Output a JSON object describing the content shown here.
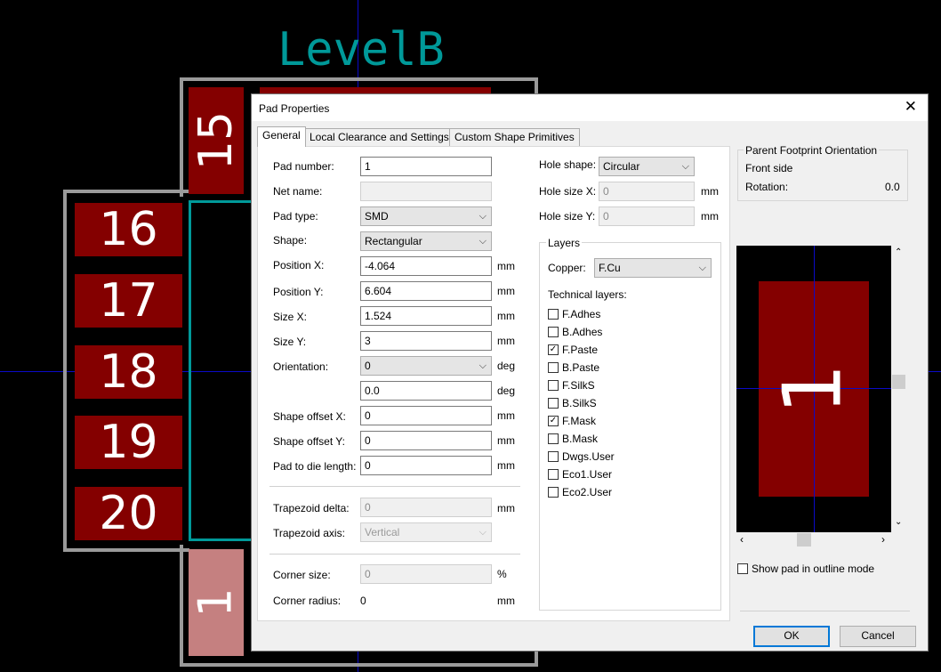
{
  "pcb": {
    "footprint_label": "LevelB",
    "pads_left": [
      "16",
      "17",
      "18",
      "19",
      "20"
    ],
    "pad_top": "15",
    "pad_bottom_selected": "1"
  },
  "dialog": {
    "title": "Pad Properties",
    "tabs": [
      "General",
      "Local Clearance and Settings",
      "Custom Shape Primitives"
    ],
    "fields": {
      "pad_number": {
        "label": "Pad number:",
        "value": "1"
      },
      "net_name": {
        "label": "Net name:",
        "value": ""
      },
      "pad_type": {
        "label": "Pad type:",
        "value": "SMD"
      },
      "shape": {
        "label": "Shape:",
        "value": "Rectangular"
      },
      "position_x": {
        "label": "Position X:",
        "value": "-4.064",
        "unit": "mm"
      },
      "position_y": {
        "label": "Position Y:",
        "value": "6.604",
        "unit": "mm"
      },
      "size_x": {
        "label": "Size X:",
        "value": "1.524",
        "unit": "mm"
      },
      "size_y": {
        "label": "Size Y:",
        "value": "3",
        "unit": "mm"
      },
      "orientation": {
        "label": "Orientation:",
        "value": "0",
        "unit": "deg"
      },
      "orientation_custom": {
        "value": "0.0",
        "unit": "deg"
      },
      "shape_offset_x": {
        "label": "Shape offset X:",
        "value": "0",
        "unit": "mm"
      },
      "shape_offset_y": {
        "label": "Shape offset Y:",
        "value": "0",
        "unit": "mm"
      },
      "pad_to_die": {
        "label": "Pad to die length:",
        "value": "0",
        "unit": "mm"
      },
      "trapezoid_delta": {
        "label": "Trapezoid delta:",
        "value": "0",
        "unit": "mm"
      },
      "trapezoid_axis": {
        "label": "Trapezoid axis:",
        "value": "Vertical"
      },
      "corner_size": {
        "label": "Corner size:",
        "value": "0",
        "unit": "%"
      },
      "corner_radius": {
        "label": "Corner radius:",
        "value": "0",
        "unit": "mm"
      }
    },
    "hole": {
      "shape": {
        "label": "Hole shape:",
        "value": "Circular"
      },
      "size_x": {
        "label": "Hole size X:",
        "value": "0",
        "unit": "mm"
      },
      "size_y": {
        "label": "Hole size Y:",
        "value": "0",
        "unit": "mm"
      }
    },
    "layers": {
      "group_label": "Layers",
      "copper_label": "Copper:",
      "copper_value": "F.Cu",
      "technical_label": "Technical layers:",
      "items": [
        {
          "name": "F.Adhes",
          "checked": false
        },
        {
          "name": "B.Adhes",
          "checked": false
        },
        {
          "name": "F.Paste",
          "checked": true
        },
        {
          "name": "B.Paste",
          "checked": false
        },
        {
          "name": "F.SilkS",
          "checked": false
        },
        {
          "name": "B.SilkS",
          "checked": false
        },
        {
          "name": "F.Mask",
          "checked": true
        },
        {
          "name": "B.Mask",
          "checked": false
        },
        {
          "name": "Dwgs.User",
          "checked": false
        },
        {
          "name": "Eco1.User",
          "checked": false
        },
        {
          "name": "Eco2.User",
          "checked": false
        }
      ]
    },
    "orientation_panel": {
      "title": "Parent Footprint Orientation",
      "side": "Front side",
      "rotation_label": "Rotation:",
      "rotation_value": "0.0"
    },
    "preview": {
      "pad_label": "1"
    },
    "outline_mode": {
      "label": "Show pad in outline mode",
      "checked": false
    },
    "buttons": {
      "ok": "OK",
      "cancel": "Cancel"
    }
  },
  "colors": {
    "pad": "#840000",
    "pad_selected": "#c58080",
    "courtyard": "#009999",
    "label": "#009999",
    "outline": "#9a9a9a"
  }
}
